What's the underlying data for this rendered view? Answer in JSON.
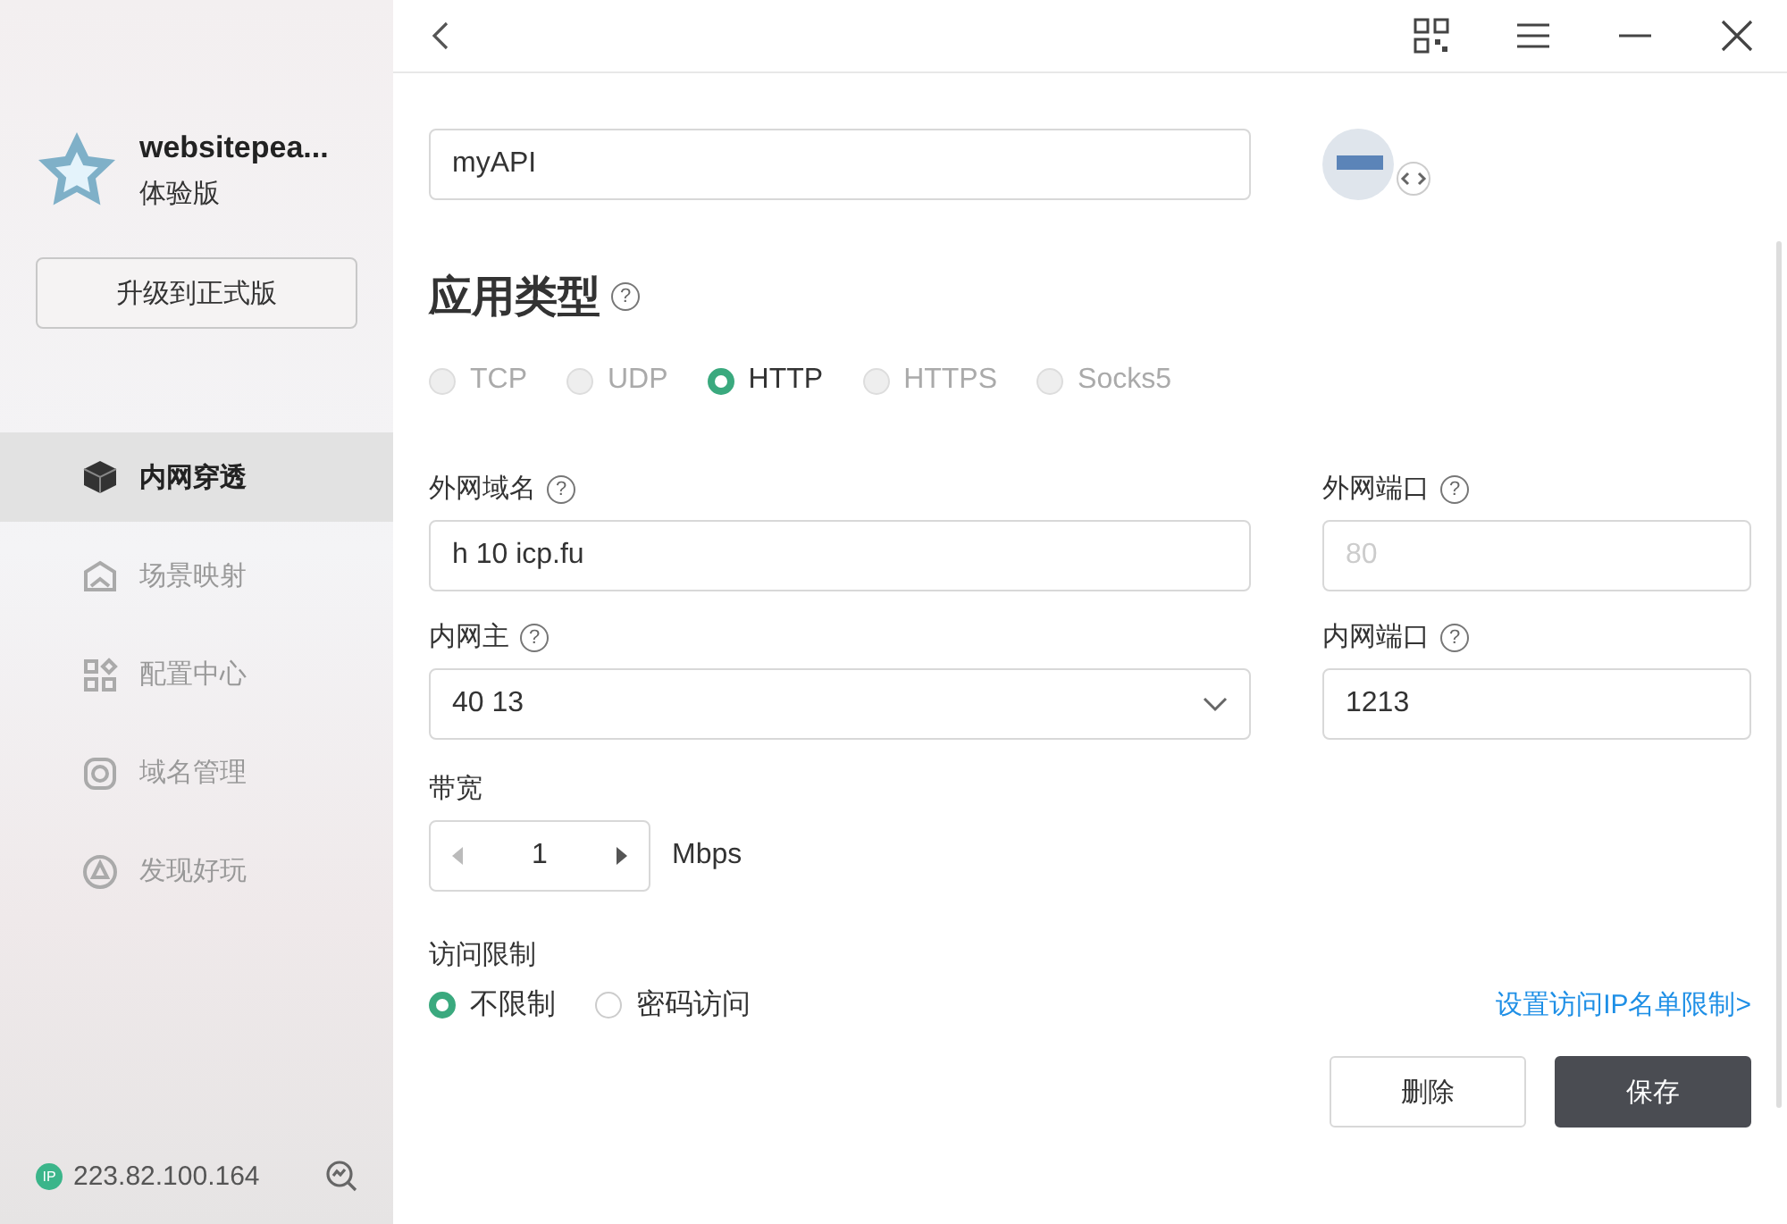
{
  "sidebar": {
    "account": {
      "name": "websitepea...",
      "edition": "体验版"
    },
    "upgrade_button": "升级到正式版",
    "items": [
      {
        "label": "内网穿透",
        "selected": true
      },
      {
        "label": "场景映射",
        "selected": false
      },
      {
        "label": "配置中心",
        "selected": false
      },
      {
        "label": "域名管理",
        "selected": false
      },
      {
        "label": "发现好玩",
        "selected": false
      }
    ],
    "ip": {
      "badge": "IP",
      "address": "223.82.100.164"
    }
  },
  "form": {
    "app_name": "myAPI",
    "app_type": {
      "title": "应用类型",
      "help": "?",
      "options": [
        {
          "label": "TCP",
          "selected": false,
          "disabled": true
        },
        {
          "label": "UDP",
          "selected": false,
          "disabled": true
        },
        {
          "label": "HTTP",
          "selected": true,
          "disabled": false
        },
        {
          "label": "HTTPS",
          "selected": false,
          "disabled": true
        },
        {
          "label": "Socks5",
          "selected": false,
          "disabled": true
        }
      ]
    },
    "fields": [
      {
        "label": "外网域名",
        "help": "?",
        "value": "h 10 icp.fu",
        "kind": "text",
        "disabled": false
      },
      {
        "label": "外网端口",
        "help": "?",
        "placeholder": "80",
        "kind": "text",
        "disabled": true
      },
      {
        "label": "内网主",
        "help": "?",
        "value": "40 13",
        "kind": "select",
        "disabled": false
      },
      {
        "label": "内网端口",
        "help": "?",
        "value": "1213",
        "kind": "text",
        "disabled": false
      }
    ],
    "bandwidth": {
      "label": "带宽",
      "value": "1",
      "unit": "Mbps"
    },
    "access": {
      "label": "访问限制",
      "options": [
        {
          "label": "不限制",
          "selected": true
        },
        {
          "label": "密码访问",
          "selected": false
        }
      ],
      "link": "设置访问IP名单限制>"
    },
    "buttons": [
      {
        "label": "删除",
        "kind": "secondary"
      },
      {
        "label": "保存",
        "kind": "primary"
      }
    ]
  }
}
